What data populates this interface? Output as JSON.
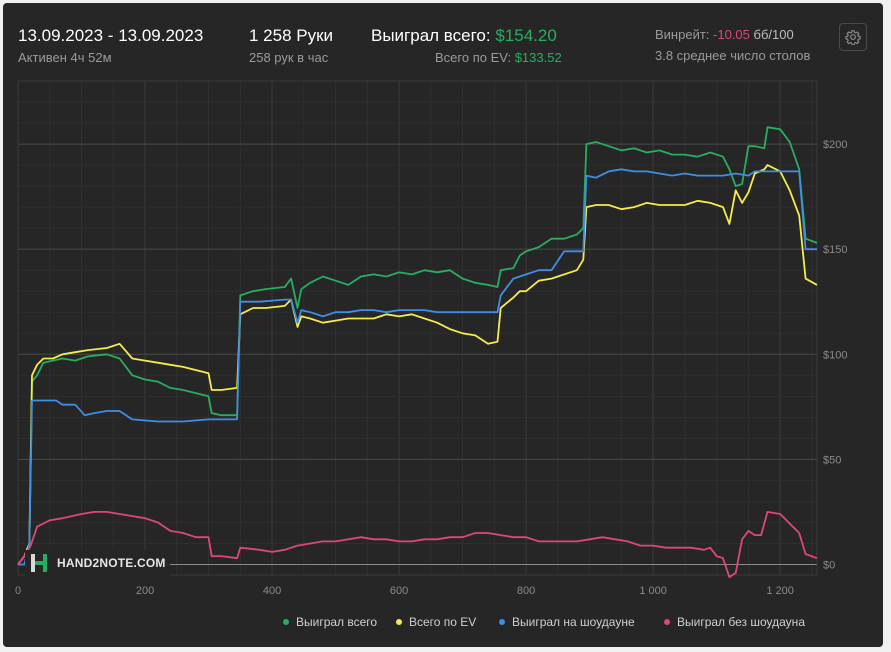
{
  "header": {
    "date_range": "13.09.2023 - 13.09.2023",
    "active_time": "Активен 4ч 52м",
    "hands_label": "1 258 Руки",
    "hands_per_hour": "258 рук в час",
    "won_label": "Выиграл всего:",
    "won_value": "$154.20",
    "ev_label": "Всего по EV:",
    "ev_value": "$133.52",
    "winrate_label": "Винрейт:",
    "winrate_value": "-10.05",
    "winrate_unit": "бб/100",
    "tables_avg": "3.8 среднее число столов"
  },
  "logo": {
    "text": "HAND2NOTE.COM"
  },
  "colors": {
    "won": "#27ae60",
    "ev": "#f4ec4a",
    "showdown": "#3f8ee6",
    "no_showdown": "#e0457b",
    "background": "#262626",
    "grid": "#3a3a3a"
  },
  "chart_data": {
    "type": "line",
    "xlabel": "",
    "ylabel": "",
    "xlim": [
      0,
      1258
    ],
    "ylim": [
      -5,
      230
    ],
    "x_ticks": [
      0,
      200,
      400,
      600,
      800,
      1000,
      1200
    ],
    "x_tick_labels": [
      "0",
      "200",
      "400",
      "600",
      "800",
      "1 000",
      "1 200"
    ],
    "y_ticks": [
      0,
      50,
      100,
      150,
      200
    ],
    "y_tick_labels": [
      "$0",
      "$50",
      "$100",
      "$150",
      "$200"
    ],
    "grid": true,
    "legend_position": "bottom-right",
    "series": [
      {
        "name": "Выиграл всего",
        "color": "#27ae60",
        "points": [
          [
            0,
            0
          ],
          [
            10,
            4
          ],
          [
            18,
            10
          ],
          [
            22,
            87
          ],
          [
            30,
            90
          ],
          [
            40,
            96
          ],
          [
            55,
            97
          ],
          [
            70,
            98
          ],
          [
            90,
            97
          ],
          [
            110,
            99
          ],
          [
            140,
            100
          ],
          [
            160,
            98
          ],
          [
            180,
            90
          ],
          [
            200,
            88
          ],
          [
            220,
            87
          ],
          [
            240,
            84
          ],
          [
            260,
            83
          ],
          [
            300,
            80
          ],
          [
            305,
            72
          ],
          [
            320,
            71
          ],
          [
            345,
            71
          ],
          [
            350,
            128
          ],
          [
            370,
            130
          ],
          [
            390,
            131
          ],
          [
            420,
            132
          ],
          [
            430,
            136
          ],
          [
            440,
            122
          ],
          [
            446,
            131
          ],
          [
            460,
            134
          ],
          [
            480,
            137
          ],
          [
            500,
            135
          ],
          [
            520,
            133
          ],
          [
            540,
            137
          ],
          [
            560,
            138
          ],
          [
            580,
            137
          ],
          [
            600,
            139
          ],
          [
            620,
            138
          ],
          [
            640,
            140
          ],
          [
            660,
            139
          ],
          [
            680,
            140
          ],
          [
            700,
            136
          ],
          [
            720,
            134
          ],
          [
            740,
            133
          ],
          [
            755,
            132
          ],
          [
            760,
            140
          ],
          [
            780,
            141
          ],
          [
            790,
            147
          ],
          [
            800,
            149
          ],
          [
            820,
            151
          ],
          [
            840,
            155
          ],
          [
            860,
            155
          ],
          [
            880,
            157
          ],
          [
            890,
            160
          ],
          [
            895,
            200
          ],
          [
            910,
            201
          ],
          [
            930,
            199
          ],
          [
            950,
            197
          ],
          [
            970,
            198
          ],
          [
            990,
            196
          ],
          [
            1010,
            197
          ],
          [
            1030,
            195
          ],
          [
            1050,
            195
          ],
          [
            1070,
            194
          ],
          [
            1090,
            196
          ],
          [
            1110,
            194
          ],
          [
            1120,
            188
          ],
          [
            1130,
            180
          ],
          [
            1140,
            181
          ],
          [
            1150,
            199
          ],
          [
            1160,
            199
          ],
          [
            1175,
            198
          ],
          [
            1180,
            208
          ],
          [
            1200,
            207
          ],
          [
            1215,
            201
          ],
          [
            1230,
            188
          ],
          [
            1240,
            155
          ],
          [
            1258,
            153
          ]
        ]
      },
      {
        "name": "Всего по EV",
        "color": "#f4ec4a",
        "points": [
          [
            0,
            0
          ],
          [
            10,
            4
          ],
          [
            18,
            10
          ],
          [
            22,
            90
          ],
          [
            30,
            95
          ],
          [
            40,
            98
          ],
          [
            55,
            98
          ],
          [
            70,
            100
          ],
          [
            90,
            101
          ],
          [
            110,
            102
          ],
          [
            140,
            103
          ],
          [
            160,
            105
          ],
          [
            180,
            98
          ],
          [
            200,
            97
          ],
          [
            220,
            96
          ],
          [
            240,
            95
          ],
          [
            260,
            94
          ],
          [
            300,
            91
          ],
          [
            305,
            83
          ],
          [
            320,
            83
          ],
          [
            345,
            84
          ],
          [
            350,
            119
          ],
          [
            370,
            122
          ],
          [
            390,
            122
          ],
          [
            420,
            123
          ],
          [
            430,
            126
          ],
          [
            440,
            113
          ],
          [
            446,
            118
          ],
          [
            460,
            117
          ],
          [
            480,
            115
          ],
          [
            500,
            116
          ],
          [
            520,
            117
          ],
          [
            540,
            117
          ],
          [
            560,
            117
          ],
          [
            580,
            119
          ],
          [
            600,
            118
          ],
          [
            620,
            119
          ],
          [
            640,
            117
          ],
          [
            660,
            115
          ],
          [
            680,
            112
          ],
          [
            700,
            110
          ],
          [
            720,
            109
          ],
          [
            740,
            105
          ],
          [
            755,
            106
          ],
          [
            760,
            122
          ],
          [
            780,
            127
          ],
          [
            790,
            130
          ],
          [
            800,
            130
          ],
          [
            820,
            135
          ],
          [
            840,
            136
          ],
          [
            860,
            138
          ],
          [
            880,
            140
          ],
          [
            890,
            145
          ],
          [
            895,
            170
          ],
          [
            910,
            171
          ],
          [
            930,
            171
          ],
          [
            950,
            169
          ],
          [
            970,
            170
          ],
          [
            990,
            172
          ],
          [
            1010,
            171
          ],
          [
            1030,
            171
          ],
          [
            1050,
            171
          ],
          [
            1070,
            173
          ],
          [
            1090,
            172
          ],
          [
            1110,
            170
          ],
          [
            1120,
            162
          ],
          [
            1130,
            178
          ],
          [
            1140,
            172
          ],
          [
            1150,
            177
          ],
          [
            1160,
            186
          ],
          [
            1175,
            188
          ],
          [
            1180,
            190
          ],
          [
            1200,
            187
          ],
          [
            1215,
            178
          ],
          [
            1230,
            166
          ],
          [
            1240,
            136
          ],
          [
            1258,
            133
          ]
        ]
      },
      {
        "name": "Выиграл на шоудауне",
        "color": "#3f8ee6",
        "points": [
          [
            0,
            0
          ],
          [
            10,
            0
          ],
          [
            18,
            10
          ],
          [
            22,
            78
          ],
          [
            60,
            78
          ],
          [
            70,
            76
          ],
          [
            90,
            76
          ],
          [
            105,
            71
          ],
          [
            120,
            72
          ],
          [
            140,
            73
          ],
          [
            160,
            73
          ],
          [
            180,
            69
          ],
          [
            220,
            68
          ],
          [
            260,
            68
          ],
          [
            300,
            69
          ],
          [
            345,
            69
          ],
          [
            350,
            125
          ],
          [
            380,
            125
          ],
          [
            420,
            126
          ],
          [
            430,
            126
          ],
          [
            440,
            115
          ],
          [
            446,
            121
          ],
          [
            460,
            120
          ],
          [
            480,
            118
          ],
          [
            500,
            120
          ],
          [
            520,
            120
          ],
          [
            540,
            121
          ],
          [
            560,
            121
          ],
          [
            580,
            120
          ],
          [
            600,
            121
          ],
          [
            620,
            121
          ],
          [
            640,
            121
          ],
          [
            660,
            120
          ],
          [
            680,
            120
          ],
          [
            700,
            120
          ],
          [
            720,
            120
          ],
          [
            740,
            120
          ],
          [
            755,
            120
          ],
          [
            760,
            128
          ],
          [
            780,
            136
          ],
          [
            800,
            138
          ],
          [
            820,
            140
          ],
          [
            840,
            140
          ],
          [
            860,
            149
          ],
          [
            880,
            149
          ],
          [
            890,
            149
          ],
          [
            895,
            185
          ],
          [
            910,
            184
          ],
          [
            930,
            187
          ],
          [
            950,
            188
          ],
          [
            970,
            187
          ],
          [
            990,
            187
          ],
          [
            1010,
            186
          ],
          [
            1030,
            185
          ],
          [
            1050,
            186
          ],
          [
            1070,
            185
          ],
          [
            1090,
            185
          ],
          [
            1110,
            185
          ],
          [
            1130,
            186
          ],
          [
            1150,
            185
          ],
          [
            1160,
            187
          ],
          [
            1180,
            187
          ],
          [
            1200,
            187
          ],
          [
            1230,
            187
          ],
          [
            1240,
            150
          ],
          [
            1258,
            150
          ]
        ]
      },
      {
        "name": "Выиграл без шоудауна",
        "color": "#e0457b",
        "points": [
          [
            0,
            0
          ],
          [
            10,
            4
          ],
          [
            20,
            9
          ],
          [
            30,
            18
          ],
          [
            50,
            21
          ],
          [
            70,
            22
          ],
          [
            100,
            24
          ],
          [
            120,
            25
          ],
          [
            140,
            25
          ],
          [
            160,
            24
          ],
          [
            180,
            23
          ],
          [
            200,
            22
          ],
          [
            220,
            20
          ],
          [
            240,
            16
          ],
          [
            260,
            15
          ],
          [
            280,
            13
          ],
          [
            300,
            13
          ],
          [
            305,
            4
          ],
          [
            320,
            4
          ],
          [
            345,
            3
          ],
          [
            350,
            8
          ],
          [
            380,
            7
          ],
          [
            400,
            6
          ],
          [
            420,
            7
          ],
          [
            440,
            9
          ],
          [
            460,
            10
          ],
          [
            480,
            11
          ],
          [
            500,
            11
          ],
          [
            520,
            12
          ],
          [
            540,
            13
          ],
          [
            560,
            12
          ],
          [
            580,
            12
          ],
          [
            600,
            11
          ],
          [
            620,
            11
          ],
          [
            640,
            12
          ],
          [
            660,
            12
          ],
          [
            680,
            13
          ],
          [
            700,
            13
          ],
          [
            720,
            15
          ],
          [
            740,
            15
          ],
          [
            760,
            14
          ],
          [
            780,
            13
          ],
          [
            800,
            13
          ],
          [
            820,
            11
          ],
          [
            840,
            11
          ],
          [
            860,
            11
          ],
          [
            880,
            11
          ],
          [
            900,
            12
          ],
          [
            920,
            13
          ],
          [
            940,
            12
          ],
          [
            960,
            11
          ],
          [
            980,
            9
          ],
          [
            1000,
            9
          ],
          [
            1020,
            8
          ],
          [
            1040,
            8
          ],
          [
            1060,
            8
          ],
          [
            1080,
            7
          ],
          [
            1090,
            8
          ],
          [
            1100,
            4
          ],
          [
            1110,
            3
          ],
          [
            1120,
            -6
          ],
          [
            1130,
            -4
          ],
          [
            1140,
            12
          ],
          [
            1150,
            16
          ],
          [
            1160,
            14
          ],
          [
            1170,
            14
          ],
          [
            1180,
            25
          ],
          [
            1200,
            24
          ],
          [
            1220,
            18
          ],
          [
            1230,
            15
          ],
          [
            1240,
            5
          ],
          [
            1258,
            3
          ]
        ]
      }
    ]
  }
}
